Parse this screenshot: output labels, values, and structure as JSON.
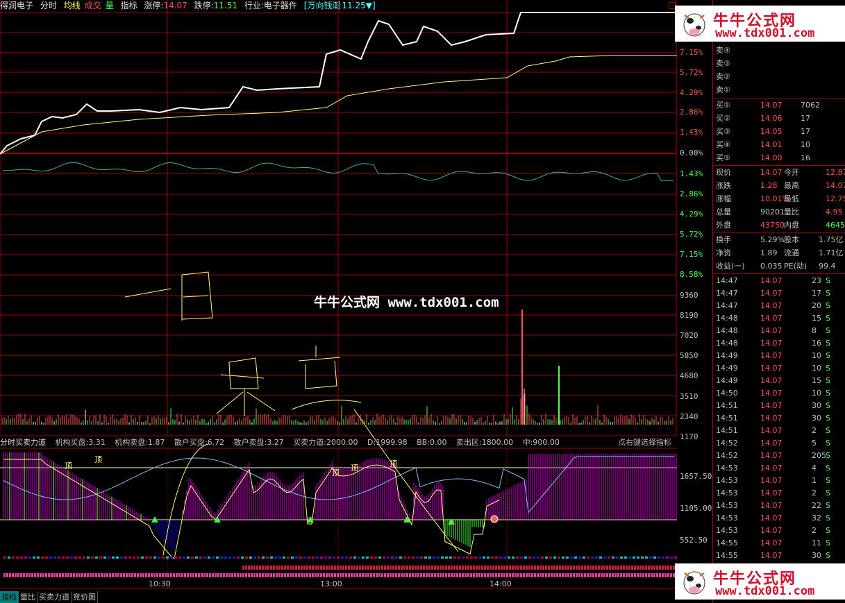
{
  "header": {
    "stock_name": "得润电子",
    "mode_time": "分时",
    "mode_avg": "均线",
    "mode_vol_a": "成交",
    "mode_vol_b": "量",
    "mode_indicator": "指标",
    "limit_up_label": "涨停:",
    "limit_up_value": "14.07",
    "limit_down_label": "跌停:",
    "limit_down_value": "11.51",
    "industry_label": "行业:",
    "industry_value": "电子器件",
    "index_name": "[万向钱潮",
    "index_value": "11.25▼]"
  },
  "price_axis": {
    "labels_up": [
      "7.15%",
      "5.72%",
      "4.29%",
      "2.86%",
      "1.43%"
    ],
    "zero": "0.00%",
    "labels_down": [
      "1.43%",
      "2.86%",
      "4.29%",
      "5.72%",
      "7.15%",
      "8.58%"
    ]
  },
  "volume_axis": [
    "9360",
    "8190",
    "7020",
    "5850",
    "4680",
    "3510",
    "2340",
    "1170"
  ],
  "indicator": {
    "name": "分时买卖力道",
    "inst_buy": "机构买盘:3.31",
    "inst_sell": "机构卖盘:1.87",
    "retail_buy": "散户买盘:6.72",
    "retail_sell": "散户卖盘:3.27",
    "force": "买卖力道:2000.00",
    "d": "D:1999.98",
    "bb": "BB:0.00",
    "sell_zone": "卖出区:1800.00",
    "mid": "中:900.00",
    "hint": "点右键选择指标",
    "axis": [
      "1657.50",
      "1105.00",
      "552.50"
    ],
    "top_marks": [
      "顶",
      "顶",
      "顶",
      "顶",
      "顶"
    ]
  },
  "time_axis": [
    "10:30",
    "13:00",
    "14:00"
  ],
  "tabs": [
    "指标",
    "量比",
    "买卖力道",
    "竞价图"
  ],
  "order_book": {
    "sells": [
      "卖④",
      "卖③",
      "卖②",
      "卖①"
    ],
    "buys": [
      {
        "label": "买①",
        "price": "14.07",
        "vol": "7062"
      },
      {
        "label": "买②",
        "price": "14.06",
        "vol": "17"
      },
      {
        "label": "买③",
        "price": "14.05",
        "vol": "17"
      },
      {
        "label": "买④",
        "price": "14.01",
        "vol": "10"
      },
      {
        "label": "买⑤",
        "price": "14.00",
        "vol": "16"
      }
    ]
  },
  "quote": [
    {
      "l1": "现价",
      "v1": "14.07",
      "l2": "今开",
      "v2": "12.87"
    },
    {
      "l1": "涨跌",
      "v1": "1.28",
      "l2": "最高",
      "v2": "14.07"
    },
    {
      "l1": "涨幅",
      "v1": "10.01%",
      "l2": "最低",
      "v2": "12.75"
    },
    {
      "l1": "总量",
      "v1": "90201",
      "l2": "量比",
      "v2": "4.95"
    },
    {
      "l1": "外盘",
      "v1": "43750",
      "l2": "内盘",
      "v2": "46451"
    }
  ],
  "finance": [
    {
      "l1": "换手",
      "v1": "5.29%",
      "l2": "股本",
      "v2": "1.75亿"
    },
    {
      "l1": "净资",
      "v1": "1.89",
      "l2": "流通",
      "v2": "1.71亿"
    },
    {
      "l1": "收益(一)",
      "v1": "0.035",
      "l2": "PE(动)",
      "v2": "99.4"
    }
  ],
  "ticks": [
    {
      "t": "14:47",
      "p": "14.07",
      "v": "23",
      "s": "S"
    },
    {
      "t": "14:47",
      "p": "14.07",
      "v": "17",
      "s": "S"
    },
    {
      "t": "14:47",
      "p": "14.07",
      "v": "20",
      "s": "S"
    },
    {
      "t": "14:48",
      "p": "14.07",
      "v": "15",
      "s": "S"
    },
    {
      "t": "14:48",
      "p": "14.07",
      "v": "8",
      "s": "S"
    },
    {
      "t": "14:48",
      "p": "14.07",
      "v": "16",
      "s": "S"
    },
    {
      "t": "14:49",
      "p": "14.07",
      "v": "10",
      "s": "S"
    },
    {
      "t": "14:49",
      "p": "14.07",
      "v": "10",
      "s": "S"
    },
    {
      "t": "14:49",
      "p": "14.07",
      "v": "15",
      "s": "S"
    },
    {
      "t": "14:50",
      "p": "14.07",
      "v": "10",
      "s": "S"
    },
    {
      "t": "14:51",
      "p": "14.07",
      "v": "30",
      "s": "S"
    },
    {
      "t": "14:51",
      "p": "14.07",
      "v": "30",
      "s": "S"
    },
    {
      "t": "14:51",
      "p": "14.07",
      "v": "2",
      "s": "S"
    },
    {
      "t": "14:52",
      "p": "14.07",
      "v": "5",
      "s": "S"
    },
    {
      "t": "14:52",
      "p": "14.07",
      "v": "205",
      "s": "S"
    },
    {
      "t": "14:53",
      "p": "14.07",
      "v": "4",
      "s": "S"
    },
    {
      "t": "14:53",
      "p": "14.07",
      "v": "1",
      "s": "S"
    },
    {
      "t": "14:53",
      "p": "14.07",
      "v": "2",
      "s": "S"
    },
    {
      "t": "14:53",
      "p": "14.07",
      "v": "22",
      "s": "S"
    },
    {
      "t": "14:53",
      "p": "14.07",
      "v": "32",
      "s": "S"
    },
    {
      "t": "14:53",
      "p": "14.07",
      "v": "2",
      "s": "S"
    },
    {
      "t": "14:55",
      "p": "14.07",
      "v": "11",
      "s": "S"
    },
    {
      "t": "14:55",
      "p": "14.07",
      "v": "30",
      "s": "S"
    }
  ],
  "watermark": {
    "title": "牛牛公式网",
    "url": "www.tdx001.com",
    "center_text": "牛牛公式网 www.tdx001.com",
    "handwriting": "一日买点"
  },
  "colors": {
    "grid": "#a00000",
    "price_line": "#ffffff",
    "avg_line": "#ffff80",
    "up": "#ff5454",
    "down": "#54ff54",
    "bar_magenta": "#d000d0",
    "bar_green": "#40ff40"
  }
}
